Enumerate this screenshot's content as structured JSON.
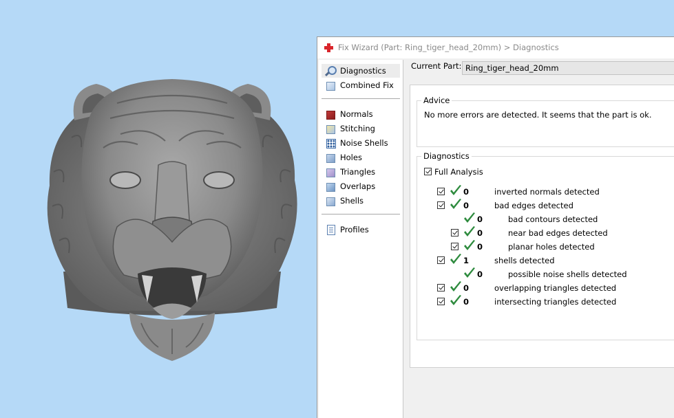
{
  "window": {
    "title": "Fix Wizard (Part: Ring_tiger_head_20mm) > Diagnostics"
  },
  "nav": {
    "items": [
      {
        "label": "Diagnostics",
        "icon": "magnifier-icon",
        "selected": true
      },
      {
        "label": "Combined Fix",
        "icon": "combined-fix-icon"
      },
      {
        "label": "Normals",
        "icon": "normals-icon"
      },
      {
        "label": "Stitching",
        "icon": "stitching-icon"
      },
      {
        "label": "Noise Shells",
        "icon": "noise-shells-icon"
      },
      {
        "label": "Holes",
        "icon": "holes-icon"
      },
      {
        "label": "Triangles",
        "icon": "triangles-icon"
      },
      {
        "label": "Overlaps",
        "icon": "overlaps-icon"
      },
      {
        "label": "Shells",
        "icon": "shells-icon"
      },
      {
        "label": "Profiles",
        "icon": "profiles-icon"
      }
    ]
  },
  "current_part": {
    "label": "Current Part:",
    "value": "Ring_tiger_head_20mm"
  },
  "advice": {
    "title": "Advice",
    "text": "No more errors are detected. It seems that the part is ok."
  },
  "diagnostics": {
    "title": "Diagnostics",
    "full_analysis_label": "Full Analysis",
    "rows": [
      {
        "count": "0",
        "label": "inverted normals detected",
        "checkbox": true,
        "indent": 0
      },
      {
        "count": "0",
        "label": "bad edges detected",
        "checkbox": true,
        "indent": 0
      },
      {
        "count": "0",
        "label": "bad contours detected",
        "checkbox": false,
        "indent": 1
      },
      {
        "count": "0",
        "label": "near bad edges detected",
        "checkbox": true,
        "indent": 1
      },
      {
        "count": "0",
        "label": "planar holes detected",
        "checkbox": true,
        "indent": 1
      },
      {
        "count": "1",
        "label": "shells detected",
        "checkbox": true,
        "indent": 0
      },
      {
        "count": "0",
        "label": "possible noise shells detected",
        "checkbox": false,
        "indent": 1
      },
      {
        "count": "0",
        "label": "overlapping triangles detected",
        "checkbox": true,
        "indent": 0
      },
      {
        "count": "0",
        "label": "intersecting triangles detected",
        "checkbox": true,
        "indent": 0
      }
    ]
  },
  "colors": {
    "viewport_bg": "#b5d9f7",
    "model_gray": "#8c8c8c",
    "tick_green": "#2e8b3e"
  }
}
